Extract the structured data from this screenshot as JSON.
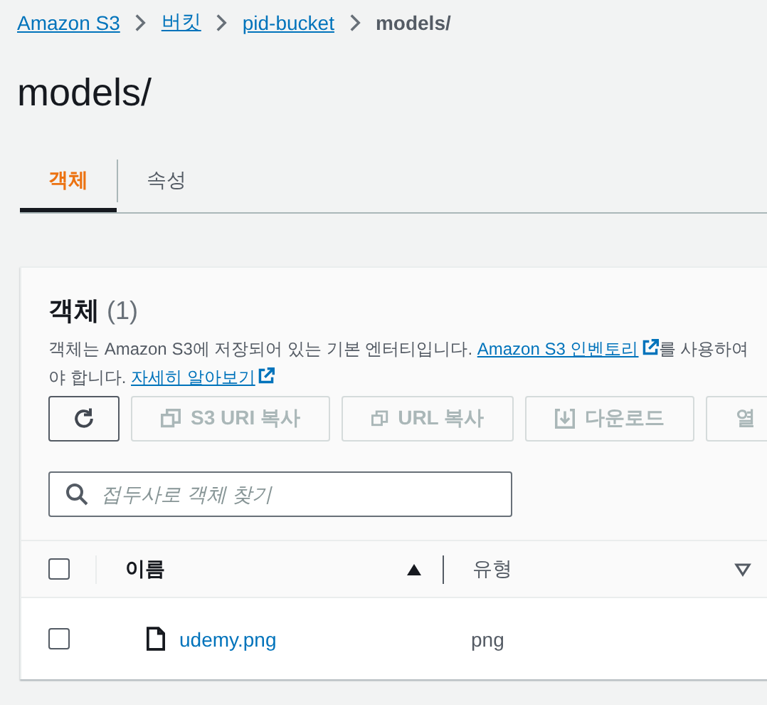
{
  "breadcrumb": [
    {
      "label": "Amazon S3",
      "kind": "link"
    },
    {
      "label": "버킷",
      "kind": "link"
    },
    {
      "label": "pid-bucket",
      "kind": "link"
    },
    {
      "label": "models/",
      "kind": "current"
    }
  ],
  "title": "models/",
  "tabs": [
    {
      "label": "객체",
      "selected": true
    },
    {
      "label": "속성",
      "selected": false
    }
  ],
  "panel": {
    "heading": "객체",
    "count": "(1)",
    "description": {
      "text_1": "객체는 Amazon S3에 저장되어 있는 기본 엔터티입니다. ",
      "link_1": "Amazon S3 인벤토리",
      "text_2": "를 사용하여 ",
      "text_3": "야 합니다. ",
      "link_2": "자세히 알아보기"
    },
    "buttons": [
      {
        "kind": "refresh",
        "disabled": false
      },
      {
        "kind": "copy",
        "label": "S3 URI 복사",
        "disabled": true
      },
      {
        "kind": "copy",
        "label": "URL 복사",
        "disabled": true
      },
      {
        "kind": "download",
        "label": "다운로드",
        "disabled": true
      },
      {
        "kind": "plain",
        "label": "열",
        "disabled": true
      }
    ],
    "search": {
      "placeholder": "접두사로 객체 찾기"
    },
    "table": {
      "select_all_checked": false,
      "columns": [
        {
          "label": "이름",
          "sorted": true
        },
        {
          "label": "유형",
          "sorted": false
        }
      ],
      "rows": [
        {
          "checked": false,
          "name": "udemy.png",
          "type": "png"
        }
      ]
    }
  }
}
